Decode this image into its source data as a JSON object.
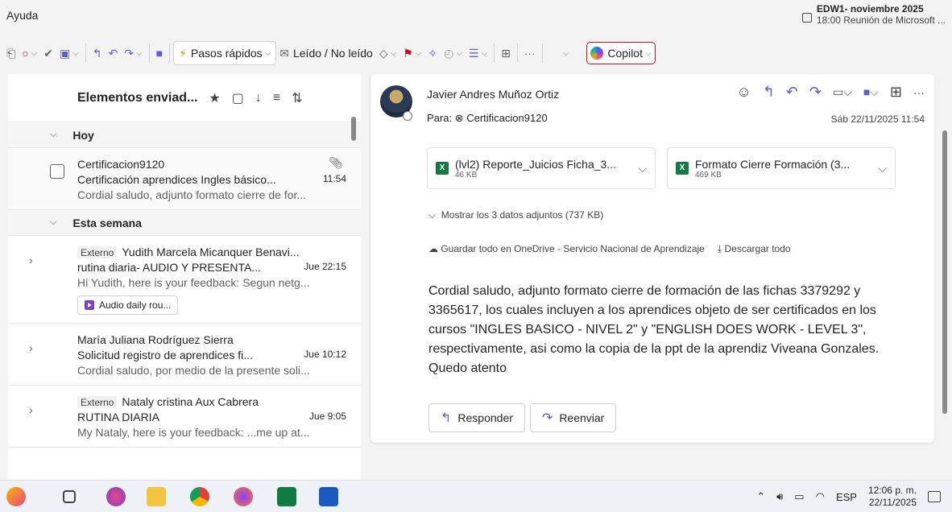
{
  "topbar": {
    "menu_help": "Ayuda",
    "calendar_title": "EDW1- noviembre 2025",
    "calendar_sub": "18:00 Reunión de Microsoft ..."
  },
  "ribbon": {
    "quick_steps": "Pasos rápidos",
    "read_unread": "Leído / No leído",
    "more": "···",
    "copilot": "Copilot"
  },
  "list": {
    "folder_title": "Elementos enviad...",
    "group_today": "Hoy",
    "group_week": "Esta semana",
    "mails": [
      {
        "to": "Certificacion9120",
        "subject": "Certificación aprendices Ingles básico...",
        "time": "11:54",
        "preview": "Cordial saludo, adjunto formato cierre de for..."
      },
      {
        "tag": "Externo",
        "to": "Yudith Marcela Micanquer Benavi...",
        "subject": "rutina diaria- AUDIO Y PRESENTA...",
        "time": "Jue 22:15",
        "preview": "Hi Yudith, here is your feedback: Segun netg...",
        "chip": "Audio daily rou..."
      },
      {
        "to": "María Juliana Rodríguez Sierra",
        "subject": "Solicitud registro de aprendices fi...",
        "time": "Jue 10:12",
        "preview": "Cordial saludo, por medio de la presente soli..."
      },
      {
        "tag": "Externo",
        "to": "Nataly cristina Aux Cabrera",
        "subject": "RUTINA DIARIA",
        "time": "Jue 9:05",
        "preview": "My Nataly, here is your feedback: ...me up at..."
      }
    ]
  },
  "reading": {
    "sender": "Javier Andres Muñoz Ortiz",
    "to_label": "Para:",
    "to_name": "Certificacion9120",
    "date": "Sáb 22/11/2025 11:54",
    "attachments": [
      {
        "name": "(lvl2) Reporte_Juicios Ficha_3...",
        "size": "46 KB"
      },
      {
        "name": "Formato Cierre Formación (3...",
        "size": "469 KB"
      }
    ],
    "show_all": "Mostrar los 3 datos adjuntos (737 KB)",
    "save_onedrive": "Guardar todo en OneDrive - Servicio Nacional de Aprendizaje",
    "download_all": "Descargar todo",
    "body": "Cordial saludo, adjunto formato cierre de formación de las fichas 3379292 y 3365617, los cuales incluyen a los aprendices objeto de ser certificados en los cursos \"INGLES BASICO - NIVEL 2\" y \"ENGLISH DOES WORK - LEVEL 3\", respectivamente, asi como la copia de la ppt de la aprendiz Viveana Gonzales. Quedo atento",
    "reply": "Responder",
    "forward": "Reenviar"
  },
  "taskbar": {
    "lang": "ESP",
    "time": "12:06 p. m.",
    "date": "22/11/2025"
  }
}
